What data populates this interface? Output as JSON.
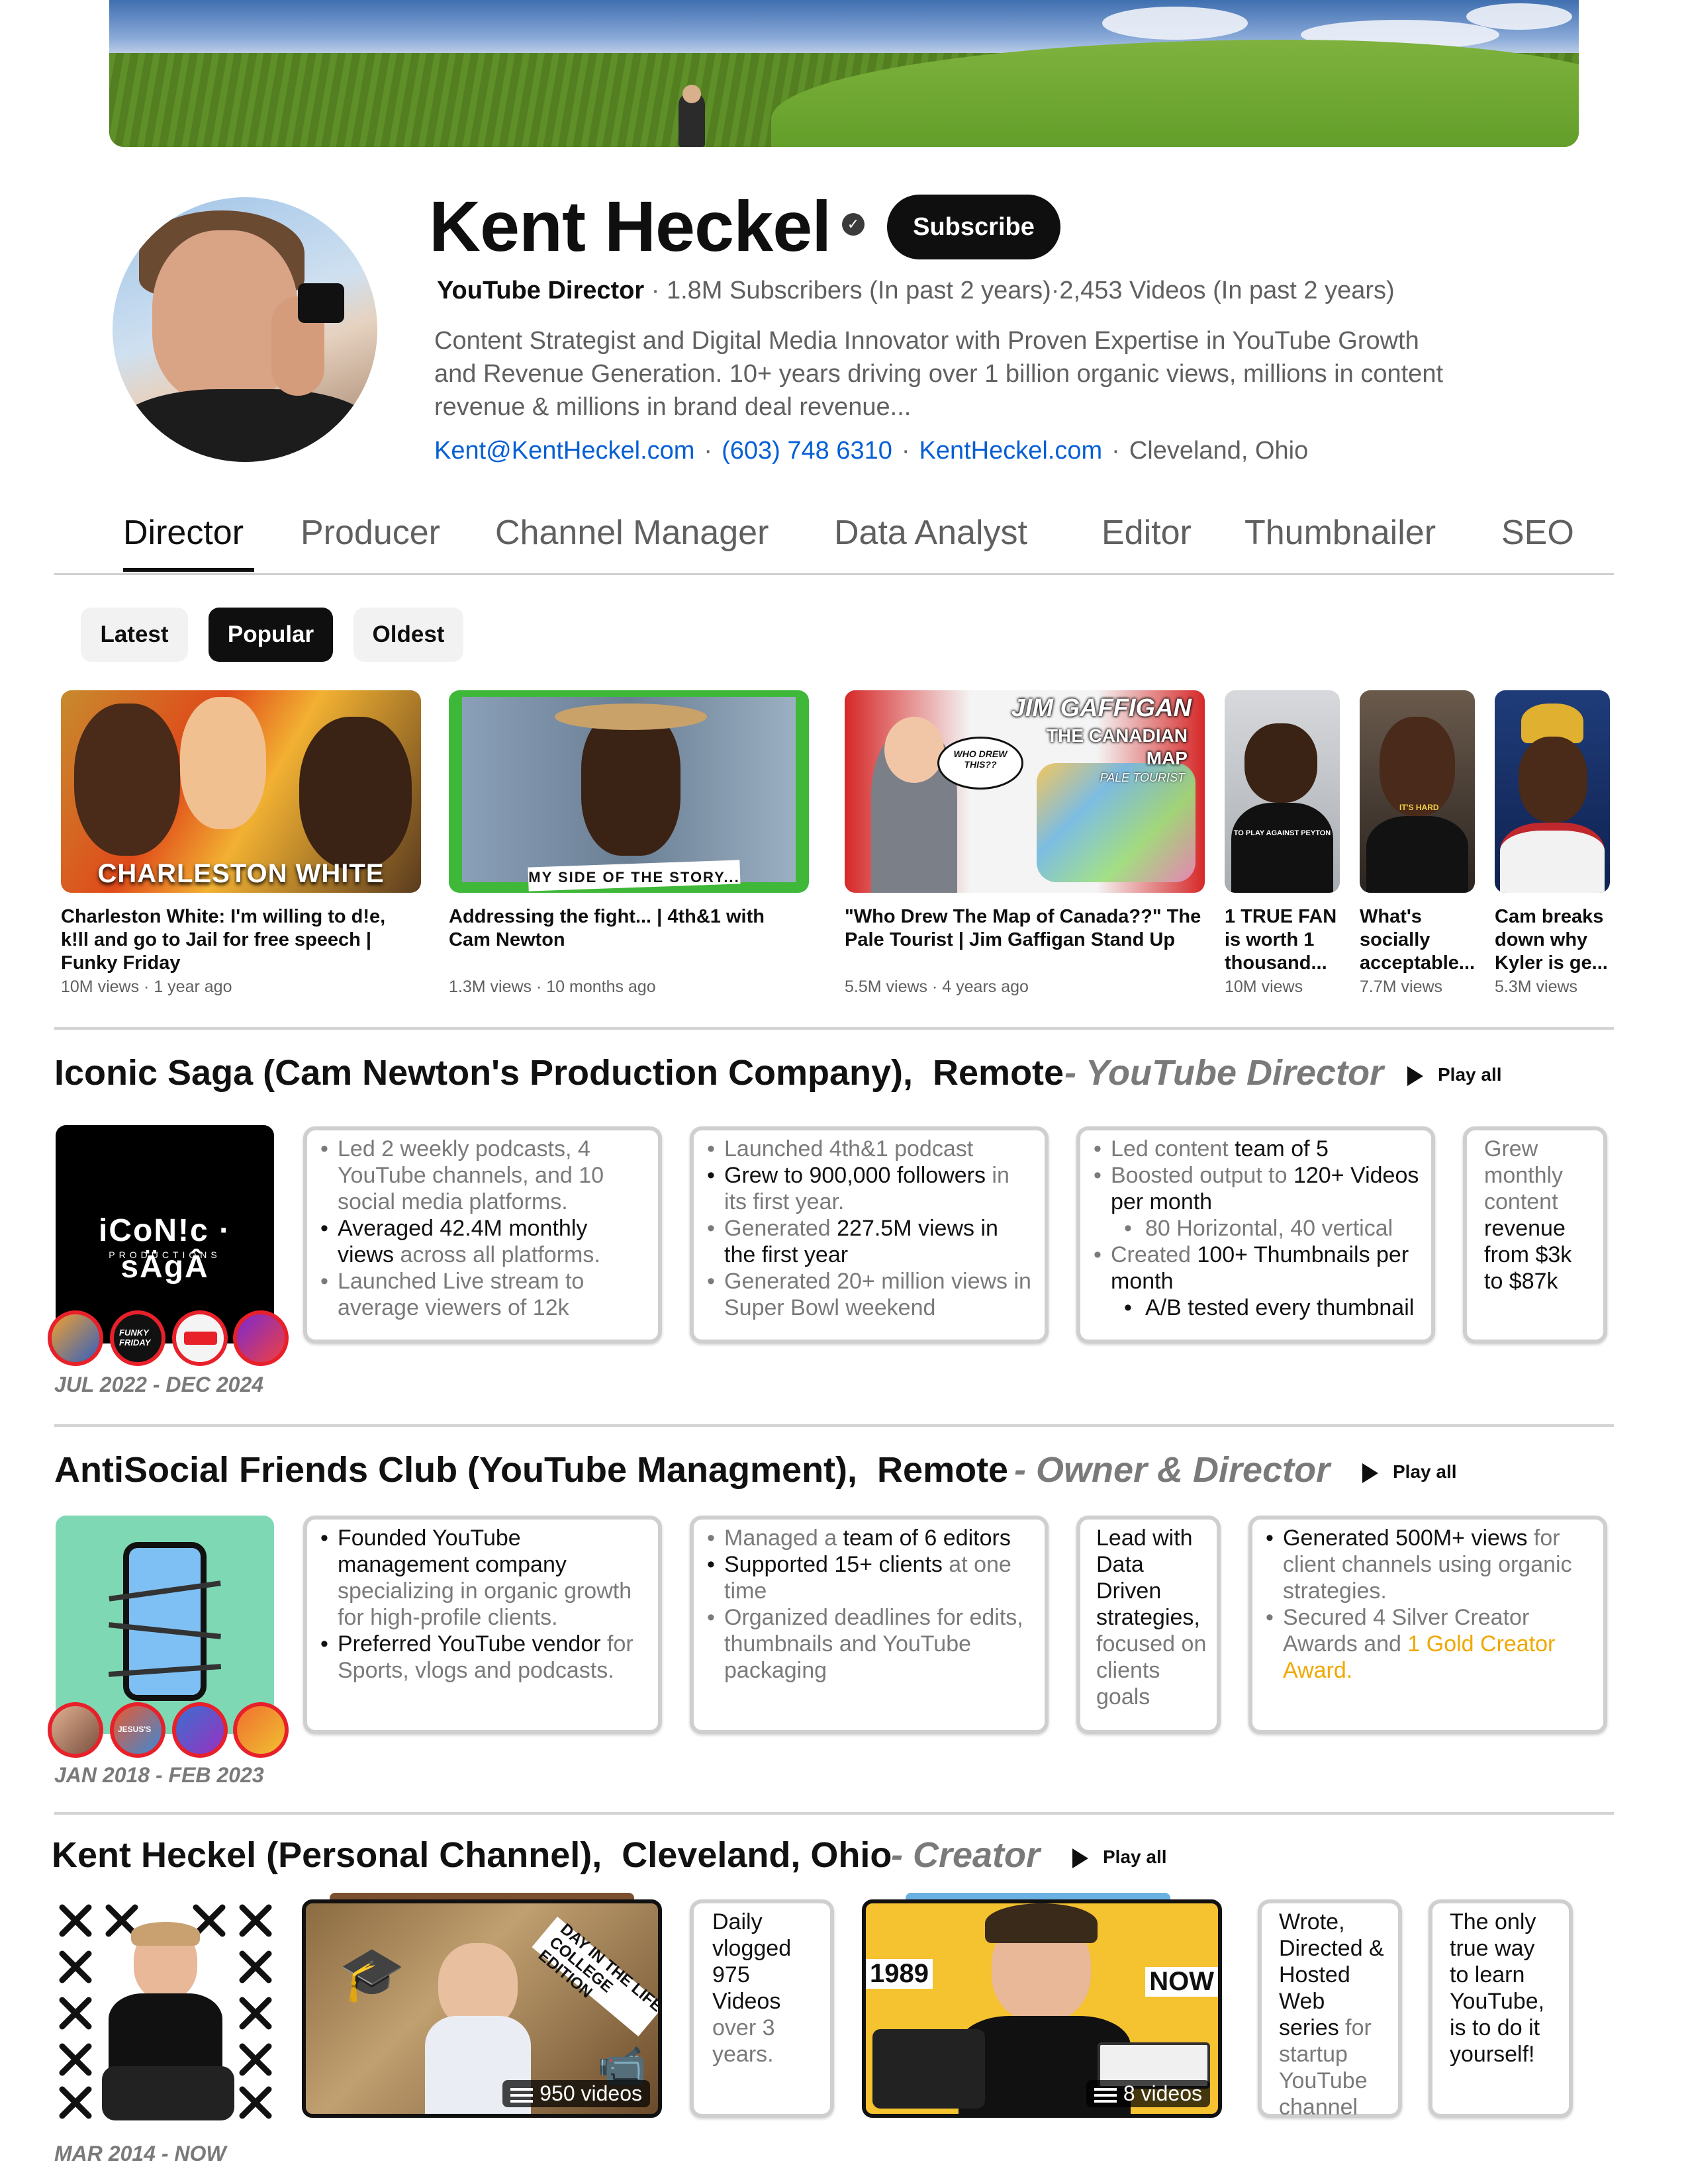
{
  "profile": {
    "name": "Kent Heckel",
    "verified_icon": "verified-check-icon",
    "subscribe_label": "Subscribe",
    "role": "YouTube Director",
    "stats_sep": "·",
    "subscribers": "1.8M Subscribers (In past 2 years)",
    "videos": "2,453 Videos (In past 2 years)",
    "description": "Content Strategist and Digital Media Innovator with Proven Expertise in YouTube Growth and Revenue Generation. 10+ years driving over 1 billion organic views, millions in content revenue & millions in brand deal revenue...",
    "email": "Kent@KentHeckel.com",
    "phone": "(603) 748 6310",
    "website": "KentHeckel.com",
    "location": "Cleveland, Ohio"
  },
  "tabs": [
    "Director",
    "Producer",
    "Channel Manager",
    "Data Analyst",
    "Editor",
    "Thumbnailer",
    "SEO"
  ],
  "chips": [
    "Latest",
    "Popular",
    "Oldest"
  ],
  "videos": [
    {
      "title": "Charleston White: I'm willing to d!e, k!ll and go to Jail for free speech | Funky Friday",
      "views": "10M views",
      "age": "1 year ago",
      "thumb_text": "CHARLESTON WHITE"
    },
    {
      "title": "Addressing the fight... | 4th&1 with Cam Newton",
      "views": "1.3M views",
      "age": "10 months ago",
      "thumb_text": "MY SIDE OF THE STORY..."
    },
    {
      "title": "\"Who Drew The Map of Canada??\" The Pale Tourist | Jim Gaffigan Stand Up",
      "views": "5.5M views",
      "age": "4 years ago",
      "thumb_text": "JIM GAFFIGAN",
      "thumb_text2": "THE CANADIAN MAP",
      "thumb_text3": "PALE TOURIST",
      "thumb_bubble": "WHO DREW THIS??"
    },
    {
      "title": "1 TRUE FAN is worth 1 thousand...",
      "views": "10M views",
      "thumb_text": "TO PLAY AGAINST PEYTON"
    },
    {
      "title": "What's socially acceptable...",
      "views": "7.7M views",
      "thumb_text": "IT'S HARD"
    },
    {
      "title": "Cam breaks down why Kyler is ge...",
      "views": "5.3M views"
    }
  ],
  "sections": [
    {
      "company": "Iconic Saga (Cam Newton's Production Company),",
      "location": "Remote",
      "role": "- YouTube Director",
      "play_all": "Play all",
      "dates": "JUL 2022 - DEC 2024",
      "logo_text": "iCoN!c · sÄgÂ",
      "logo_sub": "PRODUCTIONS",
      "mini_icon_text": "FUNKY FRIDAY",
      "card1": {
        "b1": "Led 2 weekly podcasts, 4 YouTube channels, and 10 social media platforms.",
        "b2": "Averaged 42.4M monthly views",
        "b2b": " across all platforms.",
        "b3": "Launched Live stream to average viewers of 12k"
      },
      "card2": {
        "b1": "Launched 4th&1 podcast",
        "b2": "Grew to 900,000 followers",
        "b2b": " in its first year.",
        "b3a": "Generated ",
        "b3b": "227.5M views in the first year",
        "b4": "Generated 20+ million views in Super Bowl weekend"
      },
      "card3": {
        "b1a": "Led content ",
        "b1b": "team of 5",
        "b2a": "Boosted output to ",
        "b2b": "120+ Videos per month",
        "b3": "80 Horizontal, 40 vertical",
        "b4a": "Created ",
        "b4b": "100+ Thumbnails per month",
        "b5": "A/B tested every thumbnail"
      },
      "card4": {
        "a": "Grew monthly content ",
        "b": "revenue from $3k to $87k"
      }
    },
    {
      "company": "AntiSocial Friends Club (YouTube Managment),",
      "location": "Remote",
      "role": "- Owner & Director",
      "play_all": "Play all",
      "dates": "JAN 2018 - FEB 2023",
      "mini_icon_text": "JESUS'S",
      "card1": {
        "b1": "Founded YouTube management company",
        "b1b": " specializing in organic growth for high-profile clients.",
        "b2": "Preferred YouTube vendor",
        "b2b": " for Sports, vlogs and podcasts."
      },
      "card2": {
        "b1a": "Managed a ",
        "b1b": "team of 6 editors",
        "b2a": "Supported ",
        "b2b": "15+ clients",
        "b2c": " at one time",
        "b3": "Organized deadlines for edits, thumbnails and YouTube packaging"
      },
      "card3": {
        "a": "Lead with Data Driven strategies,",
        "b": " focused on clients goals"
      },
      "card4": {
        "b1": "Generated 500M+ views",
        "b1b": " for client channels using organic strategies.",
        "b2": "Secured 4 Silver Creator Awards and ",
        "b2b": "1 Gold Creator Award."
      }
    },
    {
      "company": "Kent Heckel (Personal Channel),",
      "location": "Cleveland, Ohio",
      "role": "- Creator",
      "play_all": "Play all",
      "dates": "MAR 2014 - NOW",
      "playlist1_count": "950 videos",
      "playlist1_banner": "DAY IN THE LIFE COLLEGE EDITION",
      "playlist2_count": "8 videos",
      "playlist2_left": "1989",
      "playlist2_right": "NOW",
      "card1": {
        "a": "Daily vlogged 975 Videos",
        "b": " over 3 years."
      },
      "card2": {
        "a": "Wrote, Directed & Hosted Web series",
        "b": " for startup YouTube channel"
      },
      "card3": {
        "a": "The only true way to learn YouTube, is to do it yourself!"
      }
    }
  ],
  "colors": {
    "accent_link": "#065fd4",
    "gold": "#f0a800",
    "brand_red": "#e8202a",
    "text_muted": "#606060"
  }
}
